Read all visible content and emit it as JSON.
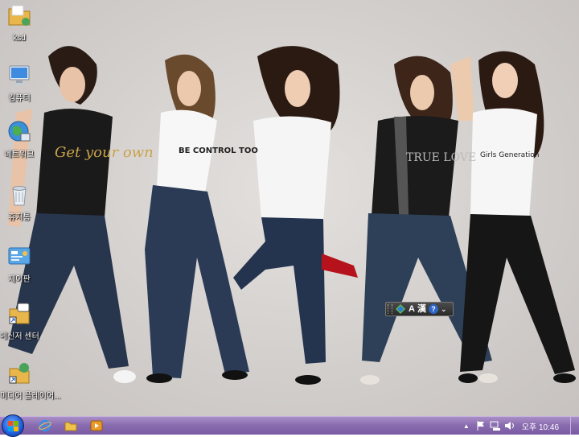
{
  "desktop": {
    "icons": [
      {
        "name": "ksd-folder",
        "label": "ksd",
        "icon": "folder-icon"
      },
      {
        "name": "computer",
        "label": "컴퓨터",
        "icon": "computer-icon"
      },
      {
        "name": "network",
        "label": "네트워크",
        "icon": "network-globe-icon"
      },
      {
        "name": "recycle-bin",
        "label": "휴지통",
        "icon": "recycle-bin-icon"
      },
      {
        "name": "control-panel",
        "label": "제어판",
        "icon": "control-panel-icon"
      },
      {
        "name": "messenger-center",
        "label": "메신저 센터",
        "icon": "messenger-shortcut-icon"
      },
      {
        "name": "media-shortcut",
        "label": "미디어 플레이어...",
        "icon": "media-shortcut-icon"
      }
    ],
    "wallpaper": {
      "shirt_texts": [
        "Get your own",
        "BE CONTROL TOO",
        "TRUE LOVE",
        "Girls Generation"
      ]
    }
  },
  "language_bar": {
    "mode_label": "A",
    "hanja_label": "漢",
    "help_label": "?",
    "menu_label": "⌄"
  },
  "taskbar": {
    "start_icon": "windows-start-orb-icon",
    "pinned": [
      {
        "name": "internet-explorer",
        "icon": "internet-explorer-icon"
      },
      {
        "name": "windows-explorer",
        "icon": "folder-icon"
      },
      {
        "name": "media-player",
        "icon": "media-player-icon"
      }
    ],
    "tray": {
      "expand_label": "▲",
      "clock": "오후 10:46"
    }
  },
  "colors": {
    "taskbar": "#8a6db0",
    "desktop_bg": "#d3cfcd"
  }
}
